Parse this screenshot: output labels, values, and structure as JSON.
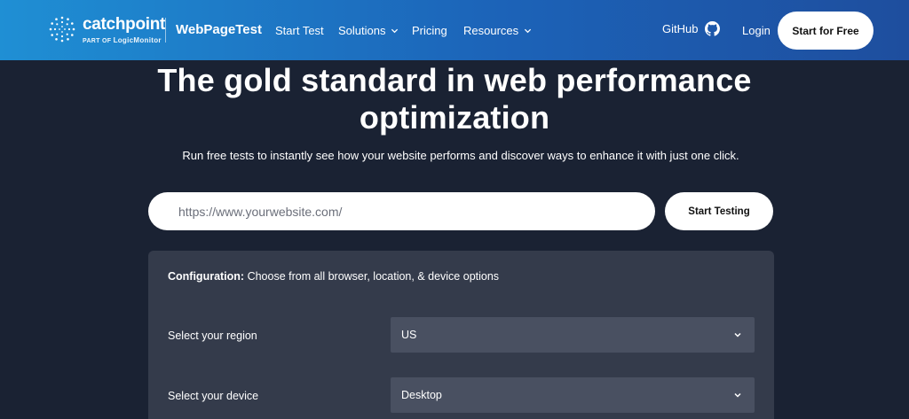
{
  "header": {
    "brand_name": "catchpoint",
    "brand_sub_prefix": "PART OF",
    "brand_sub_company": "LogicMonitor",
    "product_name": "WebPageTest",
    "nav": [
      {
        "label": "Start Test",
        "has_dropdown": false
      },
      {
        "label": "Solutions",
        "has_dropdown": true
      },
      {
        "label": "Pricing",
        "has_dropdown": false
      },
      {
        "label": "Resources",
        "has_dropdown": true
      }
    ],
    "github_label": "GitHub",
    "login_label": "Login",
    "cta_label": "Start for Free",
    "gradient_start": "#1f8fd4",
    "gradient_end": "#1e4e9e"
  },
  "hero": {
    "title_line1": "The gold standard in web performance",
    "title_line2": "optimization",
    "subtitle": "Run free tests to instantly see how your website performs and discover ways to enhance it with just one click."
  },
  "test_form": {
    "url_placeholder": "https://www.yourwebsite.com/",
    "url_value": "",
    "submit_label": "Start Testing"
  },
  "config": {
    "heading_bold": "Configuration:",
    "heading_rest": " Choose from all browser, location, & device options",
    "region_label": "Select your region",
    "region_value": "US",
    "device_label": "Select your device",
    "device_value": "Desktop"
  },
  "colors": {
    "page_bg": "#1a2233",
    "panel_bg": "#343b4b",
    "select_bg": "#495061"
  }
}
